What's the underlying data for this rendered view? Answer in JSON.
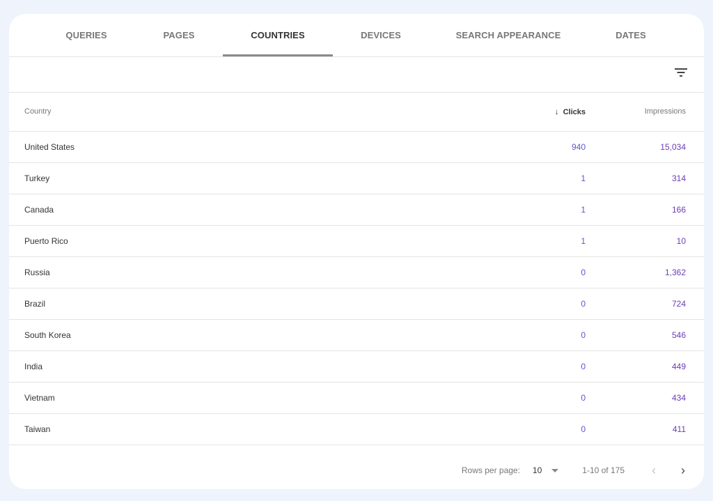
{
  "tabs": [
    {
      "label": "QUERIES",
      "active": false
    },
    {
      "label": "PAGES",
      "active": false
    },
    {
      "label": "COUNTRIES",
      "active": true
    },
    {
      "label": "DEVICES",
      "active": false
    },
    {
      "label": "SEARCH APPEARANCE",
      "active": false
    },
    {
      "label": "DATES",
      "active": false
    }
  ],
  "toolbar": {
    "filter_icon": "filter-list-icon"
  },
  "table": {
    "columns": {
      "country": "Country",
      "clicks": "Clicks",
      "impressions": "Impressions",
      "sort_column": "clicks",
      "sort_direction": "descending",
      "sort_icon": "↓"
    },
    "rows": [
      {
        "country": "United States",
        "clicks": "940",
        "impressions": "15,034"
      },
      {
        "country": "Turkey",
        "clicks": "1",
        "impressions": "314"
      },
      {
        "country": "Canada",
        "clicks": "1",
        "impressions": "166"
      },
      {
        "country": "Puerto Rico",
        "clicks": "1",
        "impressions": "10"
      },
      {
        "country": "Russia",
        "clicks": "0",
        "impressions": "1,362"
      },
      {
        "country": "Brazil",
        "clicks": "0",
        "impressions": "724"
      },
      {
        "country": "South Korea",
        "clicks": "0",
        "impressions": "546"
      },
      {
        "country": "India",
        "clicks": "0",
        "impressions": "449"
      },
      {
        "country": "Vietnam",
        "clicks": "0",
        "impressions": "434"
      },
      {
        "country": "Taiwan",
        "clicks": "0",
        "impressions": "411"
      }
    ]
  },
  "pagination": {
    "rows_per_page_label": "Rows per page:",
    "rows_per_page_value": "10",
    "range": "1-10 of 175",
    "prev_icon": "‹",
    "next_icon": "›"
  },
  "colors": {
    "clicks": "#5b57c9",
    "impressions": "#6a3cb4",
    "page_background": "#eff3fb"
  }
}
